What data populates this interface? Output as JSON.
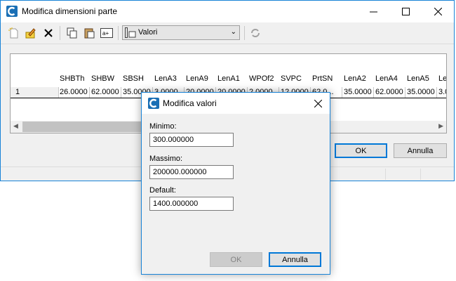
{
  "main": {
    "title": "Modifica dimensioni parte",
    "toolbar": {
      "combo_value": "Valori"
    },
    "grid": {
      "headers": [
        "SHBTh",
        "SHBW",
        "SBSH",
        "LenA3",
        "LenA9",
        "LenA1",
        "WPOf2",
        "SVPC",
        "PrtSN",
        "LenA2",
        "LenA4",
        "LenA5",
        "Le"
      ],
      "row_header": "1",
      "row_values": [
        "26.0000",
        "62.0000",
        "35.0000",
        "3.0000",
        "20.0000",
        "20.0000",
        "2.0000",
        "12.0000",
        "62.0...",
        "35.0000",
        "62.0000",
        "35.0000",
        "3.0"
      ]
    },
    "ok_label": "OK",
    "cancel_label": "Annulla"
  },
  "dialog": {
    "title": "Modifica valori",
    "min_label": "Minimo:",
    "min_value": "300.000000",
    "max_label": "Massimo:",
    "max_value": "200000.000000",
    "default_label": "Default:",
    "default_value": "1400.000000",
    "ok_label": "OK",
    "cancel_label": "Annulla"
  },
  "colors": {
    "accent": "#1883d7",
    "app_icon": "#1a6fb5"
  }
}
